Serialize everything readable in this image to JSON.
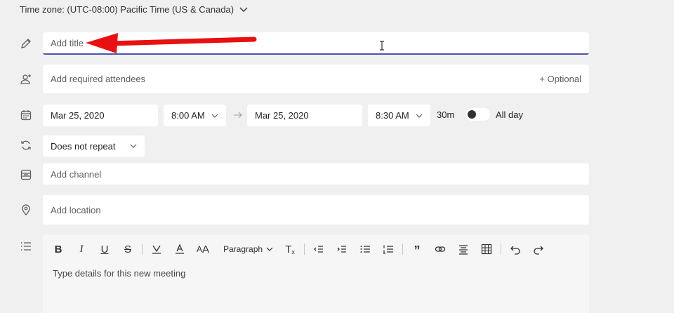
{
  "timezone": {
    "label": "Time zone: (UTC-08:00) Pacific Time (US & Canada)"
  },
  "title": {
    "placeholder": "Add title"
  },
  "attendees": {
    "placeholder": "Add required attendees",
    "optional_label": "+ Optional"
  },
  "schedule": {
    "start_date": "Mar 25, 2020",
    "start_time": "8:00 AM",
    "end_date": "Mar 25, 2020",
    "end_time": "8:30 AM",
    "duration": "30m",
    "all_day_label": "All day",
    "all_day_enabled": false
  },
  "repeat": {
    "value": "Does not repeat"
  },
  "channel": {
    "placeholder": "Add channel"
  },
  "location": {
    "placeholder": "Add location"
  },
  "editor": {
    "paragraph_label": "Paragraph",
    "placeholder": "Type details for this new meeting",
    "toolbar_icons": [
      "bold-icon",
      "italic-icon",
      "underline-icon",
      "strikethrough-icon",
      "highlight-icon",
      "font-color-icon",
      "font-size-icon",
      "clear-formatting-icon",
      "decrease-indent-icon",
      "increase-indent-icon",
      "bulleted-list-icon",
      "numbered-list-icon",
      "quote-icon",
      "link-icon",
      "align-icon",
      "table-icon",
      "undo-icon",
      "redo-icon"
    ]
  },
  "colors": {
    "accent": "#4f52b2",
    "annotation_arrow": "#e81010",
    "background": "#f0f0f0",
    "field": "#ffffff"
  }
}
